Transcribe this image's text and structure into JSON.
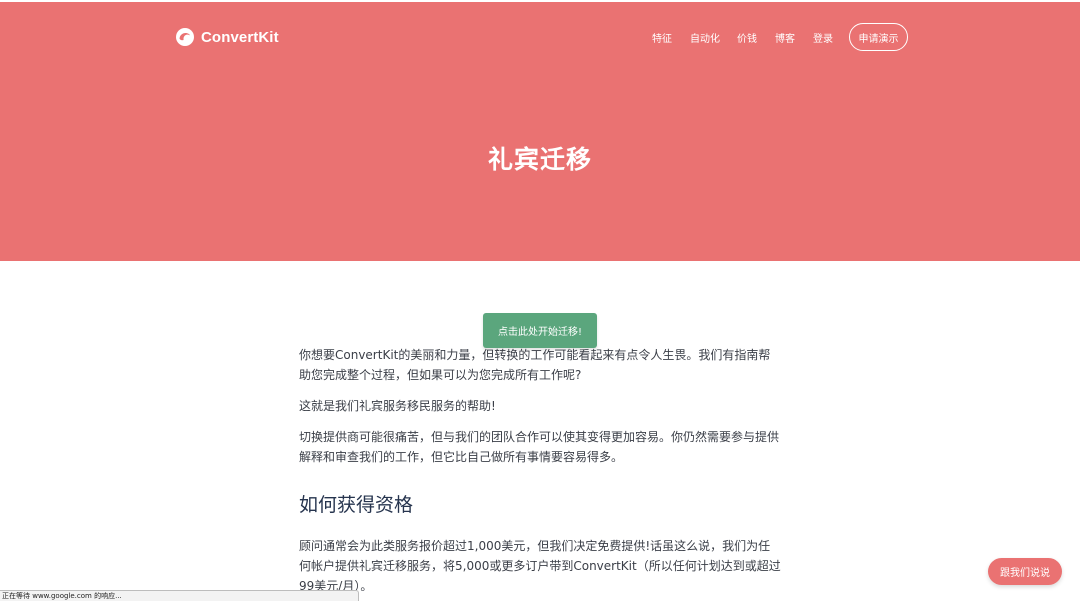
{
  "header": {
    "brand": "ConvertKit",
    "logo_icon": "convertkit-logo-icon",
    "brand_color": "#ea7272",
    "nav": [
      {
        "label": "特征"
      },
      {
        "label": "自动化"
      },
      {
        "label": "价钱"
      },
      {
        "label": "博客"
      },
      {
        "label": "登录"
      }
    ],
    "demo_button": "申请演示"
  },
  "hero": {
    "title": "礼宾迁移"
  },
  "cta": {
    "label": "点击此处开始迁移!",
    "color": "#5ba67d"
  },
  "content": {
    "paragraphs": [
      "你想要ConvertKit的美丽和力量，但转换的工作可能看起来有点令人生畏。我们有指南帮助您完成整个过程，但如果可以为您完成所有工作呢?",
      "这就是我们礼宾服务移民服务的帮助!",
      "切换提供商可能很痛苦，但与我们的团队合作可以使其变得更加容易。你仍然需要参与提供解释和审查我们的工作，但它比自己做所有事情要容易得多。"
    ],
    "heading": "如何获得资格",
    "heading_paragraph": "顾问通常会为此类服务报价超过1,000美元，但我们决定免费提供!话虽这么说，我们为任何帐户提供礼宾迁移服务，将5,000或更多订户带到ConvertKit（所以任何计划达到或超过99美元/月）。"
  },
  "chat": {
    "label": "跟我们说说"
  },
  "status_bar": {
    "text": "正在等待 www.google.com 的响应..."
  }
}
